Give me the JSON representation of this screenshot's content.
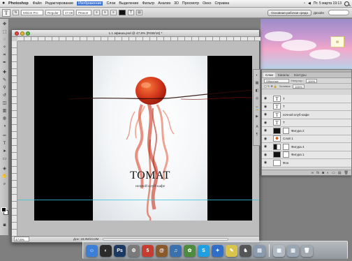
{
  "menubar": {
    "app_name": "Photoshop",
    "items": [
      "Файл",
      "Редактирование",
      "Изображение",
      "Слои",
      "Выделение",
      "Фильтр",
      "Анализ",
      "3D",
      "Просмотр",
      "Окно",
      "Справка"
    ],
    "active_item": "Изображение",
    "clock": "Пт. 5 марта  19:13"
  },
  "options": {
    "font_family": "Minion Pro",
    "font_style": "Regular",
    "font_size": "47,68",
    "anti_alias": "Резкое",
    "leading": "",
    "workspace_button": "Основная рабочая среда",
    "workspace_menu": "Дизайн"
  },
  "document": {
    "title": "1.1 афиша.psd @ 47,6% (RGB/16) *",
    "zoom": "47,6%",
    "doc_info": "Док: 18,8М/23,8М",
    "poster_title": "ТОМАТ",
    "poster_subtitle": "ночной клуб-кафе"
  },
  "layers_panel": {
    "tabs": [
      "Слои",
      "Каналы",
      "Контуры"
    ],
    "active_tab": "Слои",
    "blend_mode": "Обычные",
    "opacity_label": "Непрозр.:",
    "opacity": "100%",
    "fill_label": "Заливка:",
    "fill": "100%",
    "layers": [
      {
        "name": "Т",
        "thumb": "text",
        "selected": false
      },
      {
        "name": "Т",
        "thumb": "text",
        "selected": false
      },
      {
        "name": "ночной клуб-кафе",
        "thumb": "text",
        "selected": false
      },
      {
        "name": "Т",
        "thumb": "text",
        "selected": false
      },
      {
        "name": "Фигура 2",
        "thumb": "dark",
        "selected": false
      },
      {
        "name": "Слой 1",
        "thumb": "tomato",
        "selected": false
      },
      {
        "name": "Фигура 4",
        "thumb": "split",
        "selected": false
      },
      {
        "name": "Фигура 1",
        "thumb": "dark",
        "selected": false
      },
      {
        "name": "Фон",
        "thumb": "white",
        "selected": false
      }
    ]
  },
  "dock": {
    "apps": [
      {
        "name": "finder",
        "glyph": "☺",
        "color": "#3c7fd6"
      },
      {
        "name": "dashboard",
        "glyph": "◐",
        "color": "#2b2b2b"
      },
      {
        "name": "photoshop",
        "glyph": "Ps",
        "color": "#1b3a63"
      },
      {
        "name": "system-preferences",
        "glyph": "⚙",
        "color": "#7a7a7a"
      },
      {
        "name": "ical",
        "glyph": "5",
        "color": "#c83b2f"
      },
      {
        "name": "address-book",
        "glyph": "@",
        "color": "#8b5a2b"
      },
      {
        "name": "itunes",
        "glyph": "♫",
        "color": "#3a6fb0"
      },
      {
        "name": "iphoto",
        "glyph": "✿",
        "color": "#4d8c3c"
      },
      {
        "name": "skype",
        "glyph": "S",
        "color": "#1ea0e2"
      },
      {
        "name": "safari",
        "glyph": "✦",
        "color": "#2f6fc9"
      },
      {
        "name": "stickies",
        "glyph": "✎",
        "color": "#d8c44a"
      },
      {
        "name": "chess",
        "glyph": "♞",
        "color": "#555555"
      },
      {
        "name": "preview",
        "glyph": "▤",
        "color": "#8a9bb0"
      }
    ],
    "stacks": [
      {
        "name": "documents-stack",
        "glyph": "▦",
        "color": "#b0b8c2"
      },
      {
        "name": "downloads-stack",
        "glyph": "▥",
        "color": "#9aa6b4"
      },
      {
        "name": "trash",
        "glyph": "🗑",
        "color": "#a0a8b0"
      }
    ]
  },
  "colors": {
    "accent_tomato": "#d5391c",
    "guide": "#38c5d8"
  }
}
